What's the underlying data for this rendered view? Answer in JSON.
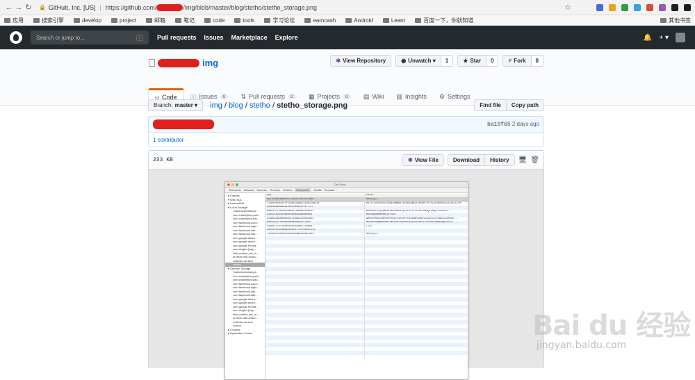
{
  "browser": {
    "site_label": "GitHub, Inc. [US]",
    "url_prefix": "https://github.com/",
    "url_suffix": "/img/blob/master/blog/stetho/stetho_storage.png",
    "ext_colors": [
      "#4b6bd6",
      "#f0a020",
      "#2e9e44",
      "#3aa0e0",
      "#d94b3d",
      "#9b59b6",
      "#1f1f1f",
      "#1e1e1e"
    ]
  },
  "bookmarks": {
    "items": [
      "应用",
      "搜索引擎",
      "develop",
      "project",
      "邮箱",
      "笔记",
      "code",
      "tools",
      "学习论坛",
      "earncash",
      "Android",
      "Learn",
      "百度一下，你就知道"
    ],
    "other": "其他书签"
  },
  "github_header": {
    "search_placeholder": "Search or jump to...",
    "search_hint": "/",
    "nav": [
      "Pull requests",
      "Issues",
      "Marketplace",
      "Explore"
    ],
    "bell_icon": "bell-icon",
    "plus_label": "+ ▾"
  },
  "repo": {
    "name": "img",
    "actions": {
      "view_repository": "View Repository",
      "unwatch": "Unwatch ▾",
      "unwatch_count": "1",
      "star": "Star",
      "star_count": "0",
      "fork": "Fork",
      "fork_count": "0"
    },
    "tabs": [
      {
        "label": "Code",
        "count": ""
      },
      {
        "label": "Issues",
        "count": "0"
      },
      {
        "label": "Pull requests",
        "count": "0"
      },
      {
        "label": "Projects",
        "count": "0"
      },
      {
        "label": "Wiki",
        "count": ""
      },
      {
        "label": "Insights",
        "count": ""
      },
      {
        "label": "Settings",
        "count": ""
      }
    ]
  },
  "file_nav": {
    "branch_prefix": "Branch:",
    "branch_name": "master ▾",
    "crumbs": [
      "img",
      "blog",
      "stetho"
    ],
    "filename": "stetho_storage.png",
    "find_file": "Find file",
    "copy_path": "Copy path"
  },
  "commit": {
    "sha": "ba19f65",
    "age": "2 days ago",
    "contributors": "1 contributor"
  },
  "file": {
    "size": "233 KB",
    "view_file": "View File",
    "download": "Download",
    "history": "History"
  },
  "devtools": {
    "title": "DevTools",
    "tabs": [
      "Elements",
      "Network",
      "Sources",
      "Timeline",
      "Profiles",
      "Resources",
      "Audits",
      "Console"
    ],
    "active_tab": "Resources",
    "sidebar": [
      {
        "label": "▸ Frames",
        "indent": false,
        "sel": false
      },
      {
        "label": "▾ Web SQL",
        "indent": false,
        "sel": false
      },
      {
        "label": "▸ IndexedDB",
        "indent": false,
        "sel": false
      },
      {
        "label": "▾ Local Storage",
        "indent": false,
        "sel": false
      },
      {
        "label": "TwitterAdvertisingI...",
        "indent": true,
        "sel": false
      },
      {
        "label": "com.crashlytics.prefs",
        "indent": true,
        "sel": false
      },
      {
        "label": "com.crashlytics.sdk...",
        "indent": true,
        "sel": false
      },
      {
        "label": "com.facebook.Acce...",
        "indent": true,
        "sel": false
      },
      {
        "label": "com.facebook.login...",
        "indent": true,
        "sel": false
      },
      {
        "label": "com.facebook.sdk...",
        "indent": true,
        "sel": false
      },
      {
        "label": "com.facebook.sdk...",
        "indent": true,
        "sel": false
      },
      {
        "label": "com.google.andro...",
        "indent": true,
        "sel": false
      },
      {
        "label": "com.google.andro...",
        "indent": true,
        "sel": false
      },
      {
        "label": "com.google.Fireba...",
        "indent": true,
        "sel": false
      },
      {
        "label": "com.xingbo.[map...",
        "indent": true,
        "sel": false
      },
      {
        "label": "disk_entries_list_m...",
        "indent": true,
        "sel": false
      },
      {
        "label": "io.fabric.sdk.andro...",
        "indent": true,
        "sel": false
      },
      {
        "label": "multidex.version",
        "indent": true,
        "sel": false
      },
      {
        "label": "xxxxxx",
        "indent": true,
        "sel": true
      },
      {
        "label": "▾ Session Storage",
        "indent": false,
        "sel": false
      },
      {
        "label": "TwitterAdvertisingI...",
        "indent": true,
        "sel": false
      },
      {
        "label": "com.crashlytics.prefs",
        "indent": true,
        "sel": false
      },
      {
        "label": "com.crashlytics.sdk...",
        "indent": true,
        "sel": false
      },
      {
        "label": "com.facebook.Acce...",
        "indent": true,
        "sel": false
      },
      {
        "label": "com.facebook.login...",
        "indent": true,
        "sel": false
      },
      {
        "label": "com.facebook.sdk...",
        "indent": true,
        "sel": false
      },
      {
        "label": "com.facebook.sdk...",
        "indent": true,
        "sel": false
      },
      {
        "label": "com.google.andro...",
        "indent": true,
        "sel": false
      },
      {
        "label": "com.google.andro...",
        "indent": true,
        "sel": false
      },
      {
        "label": "com.google.Fireba...",
        "indent": true,
        "sel": false
      },
      {
        "label": "com.xingbo.[map...",
        "indent": true,
        "sel": false
      },
      {
        "label": "disk_entries_list_m...",
        "indent": true,
        "sel": false
      },
      {
        "label": "io.fabric.sdk.andro...",
        "indent": true,
        "sel": false
      },
      {
        "label": "multidex.version",
        "indent": true,
        "sel": false
      },
      {
        "label": "xxxxxx",
        "indent": true,
        "sel": false
      },
      {
        "label": "▸ Cookies",
        "indent": false,
        "sel": false
      },
      {
        "label": "▸ Application Cache",
        "indent": false,
        "sel": false
      }
    ],
    "columns": [
      "Key",
      "Value"
    ],
    "rows": [
      [
        "4b71c6a4f8e94fcc7dd1fc44f1927b80",
        "dHc1ZQ=="
      ],
      [
        "711d59f5d3ce7f1c9ac1588637e451564334",
        "eyJlY29uZGF0YSI6eyJnMW9nIjoiNjZmNjY1NzAxYTE3Y2ZiYmVkOGE3ZjkiLCJtb..."
      ],
      [
        "904b4ba69ad9391e9c484683f1e7717f",
        ""
      ],
      [
        "a0a0237f58c96f0a85579e5be4369b23",
        "MDAxOGZiZjk4MGYzYWFiOGE0ZjcxY2Y1YTk1MDYxN2Q1YmNjYTU4ZmI1..."
      ],
      [
        "43193782016fd5a049ca2958ad60e59",
        "bGFkQW4mcmz0Mj1vY3J0"
      ],
      [
        "9f3bb92a1ed9b6951f04a91c6b0ec9e3",
        "aHR0cHM6Ly9mYnN0YXRpYy1hLmFrYW1haWhkLm5ldC9yc3JjLnBocC92My95..."
      ],
      [
        "dd4916217cb386ad63ed6961d73a22",
        "M3UzRFRpaWNDcmVIdmZ5UzZIdGhFZGZoZUxIa3lrT2hOV2ZsNW5ZQkZsZE1..."
      ],
      [
        "0296879741110bc82e2694a5572b6bd7",
        "LTE="
      ],
      [
        "5af94e1041a69d2e851d77107eedc1112",
        ""
      ],
      [
        "7182e837de494f69094e0ad1d8de7db4",
        "dHc1ZQ=="
      ]
    ],
    "empty_rows": 32
  },
  "watermark": {
    "brand": "Bai du 经验",
    "url": "jingyan.baidu.com"
  }
}
